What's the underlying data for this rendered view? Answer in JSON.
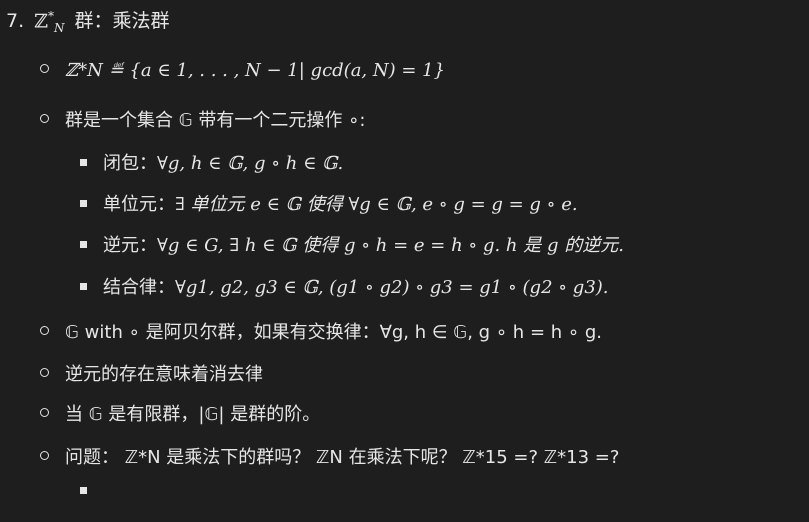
{
  "heading": {
    "number": "7.",
    "symbol": "ℤ",
    "sup": "*",
    "sub": "N",
    "title": "群：乘法群"
  },
  "items": [
    {
      "text": "ℤ*N ≝ {a ∈ 1, . . . , N − 1| gcd(a, N) = 1}"
    },
    {
      "text": "群是一个集合 𝔾 带有一个二元操作 ∘:"
    },
    {
      "text": "𝔾 with ∘ 是阿贝尔群，如果有交换律：∀g, h ∈ 𝔾, g ∘ h = h ∘ g."
    },
    {
      "text": "逆元的存在意味着消去律"
    },
    {
      "text": "当 𝔾 是有限群，|𝔾| 是群的阶。"
    },
    {
      "text": "问题： ℤ*N 是乘法下的群吗？ ℤN 在乘法下呢？ ℤ*15 =? ℤ*13 =?"
    }
  ],
  "subitems": [
    {
      "label": "闭包：",
      "math": "∀g, h ∈ 𝔾, g ∘ h ∈ 𝔾."
    },
    {
      "label": "单位元：",
      "math": "∃ 单位元 e ∈ 𝔾 使得 ∀g ∈ 𝔾, e ∘ g = g = g ∘ e."
    },
    {
      "label": "逆元：",
      "math": "∀g ∈ G, ∃ h ∈ 𝔾 使得 g ∘ h = e = h ∘ g. h 是 g 的逆元."
    },
    {
      "label": "结合律：",
      "math": "∀g1, g2, g3 ∈ 𝔾, (g1 ∘ g2) ∘ g3 = g1 ∘ (g2 ∘ g3)."
    }
  ]
}
